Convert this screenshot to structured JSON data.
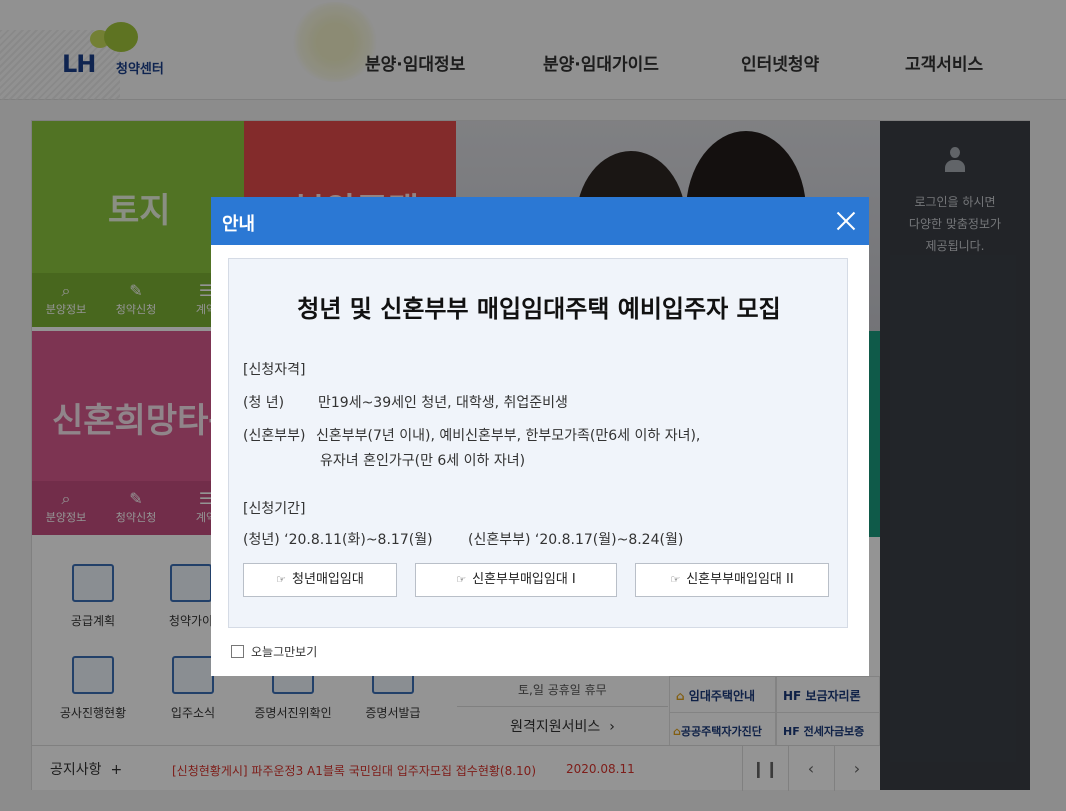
{
  "header": {
    "logo_text": "LH",
    "logo_sub": "청약센터",
    "nav": [
      "분양·임대정보",
      "분양·임대가이드",
      "인터넷청약",
      "고객서비스"
    ]
  },
  "background": {
    "tiles": {
      "land": "토지",
      "sale": "분양주택",
      "hope_town": "신혼희망타운"
    },
    "sub_menu": [
      "분양정보",
      "청약신청",
      "계약"
    ],
    "quick_links": [
      "공급계획",
      "청약가이",
      "공사진행현황",
      "입주소식",
      "증명서진위확인",
      "증명서발급"
    ],
    "holiday_text": "토,일 공휴일 휴무",
    "remote_service": "원격지원서비스",
    "remote_arrow": "›",
    "services": [
      "임대주택안내",
      "보금자리론",
      "공공주택자가진단",
      "전세자금보증"
    ],
    "login_msg": [
      "로그인을 하시면",
      "다양한 맞춤정보가",
      "제공됩니다."
    ],
    "notice": {
      "label": "공지사항",
      "plus": "+",
      "text": "[신청현황게시] 파주운정3 A1블록 국민임대 입주자모집 접수현황(8.10)",
      "date": "2020.08.11",
      "controls": [
        "❙❙",
        "‹",
        "›"
      ]
    }
  },
  "modal": {
    "title": "안내",
    "headline": "청년 및 신혼부부 매입임대주택 예비입주자 모집",
    "qualification_heading": "[신청자격]",
    "youth_label": "(청      년)",
    "youth_text": "만19세~39세인 청년, 대학생, 취업준비생",
    "newlywed_label": "(신혼부부)",
    "newlywed_text_1": "신혼부부(7년 이내), 예비신혼부부, 한부모가족(만6세 이하 자녀),",
    "newlywed_text_2": "유자녀 혼인가구(만 6세 이하 자녀)",
    "period_heading": "[신청기간]",
    "period_youth": "(청년) ‘20.8.11(화)~8.17(월)",
    "period_newlywed": "(신혼부부) ‘20.8.17(월)~8.24(월)",
    "buttons": [
      "청년매입임대",
      "신혼부부매입임대 I",
      "신혼부부매입임대 II"
    ],
    "hand_glyph": "☞",
    "today_label": "오늘그만보기"
  },
  "colors": {
    "modal_header": "#2b78d4",
    "modal_body": "#f0f4fa",
    "notice_red": "#d9352d"
  }
}
